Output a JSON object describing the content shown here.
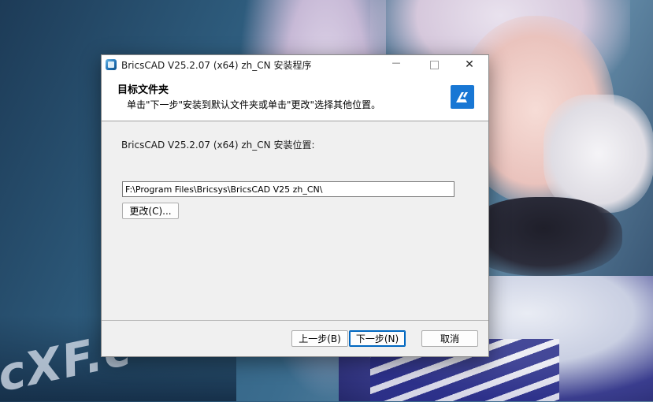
{
  "window": {
    "title": "BricsCAD V25.2.07 (x64) zh_CN 安装程序",
    "icons": {
      "app": "installer-icon",
      "minimize": "minimize-icon",
      "maximize": "maximize-icon",
      "close": "close-icon"
    },
    "minimize_glyph": "—",
    "close_glyph": "✕"
  },
  "header": {
    "title": "目标文件夹",
    "subtitle": "单击\"下一步\"安装到默认文件夹或单击\"更改\"选择其他位置。",
    "logo": "bricscad-logo-icon",
    "logo_color": "#1877d4"
  },
  "body": {
    "location_label": "BricsCAD V25.2.07 (x64) zh_CN 安装位置:",
    "path_value": "F:\\Program Files\\Bricsys\\BricsCAD V25 zh_CN\\",
    "change_button": "更改(C)..."
  },
  "footer": {
    "back_button": "上一步(B)",
    "next_button": "下一步(N)",
    "cancel_button": "取消"
  },
  "background": {
    "watermark": "cXF.c"
  }
}
